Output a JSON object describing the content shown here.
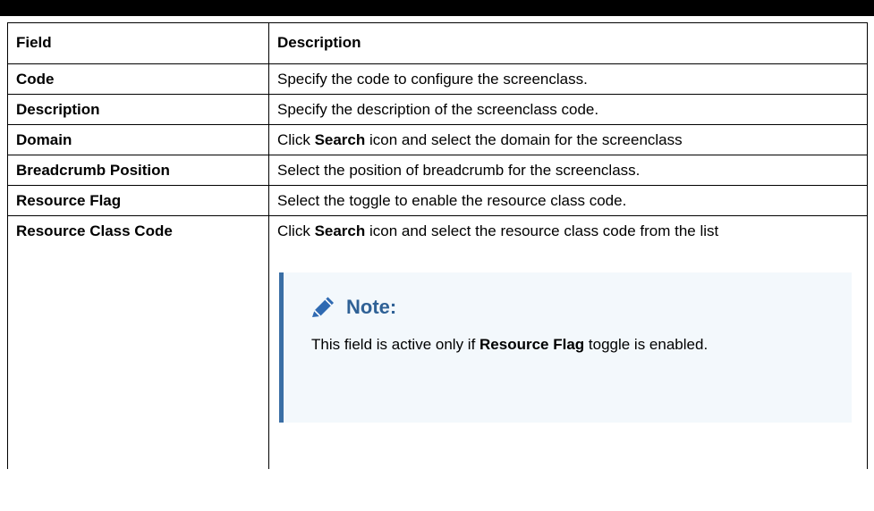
{
  "table": {
    "headers": {
      "field": "Field",
      "description": "Description"
    },
    "rows": [
      {
        "field": "Code",
        "desc_pre": "Specify the code to configure the screenclass.",
        "desc_bold": "",
        "desc_post": ""
      },
      {
        "field": "Description",
        "desc_pre": "Specify the description of the screenclass code.",
        "desc_bold": "",
        "desc_post": ""
      },
      {
        "field": "Domain",
        "desc_pre": "Click ",
        "desc_bold": "Search",
        "desc_post": " icon and select the domain for the screenclass"
      },
      {
        "field": "Breadcrumb Position",
        "desc_pre": "Select the position of breadcrumb for the screenclass.",
        "desc_bold": "",
        "desc_post": ""
      },
      {
        "field": "Resource Flag",
        "desc_pre": "Select the toggle to enable the resource class code.",
        "desc_bold": "",
        "desc_post": ""
      },
      {
        "field": "Resource Class Code",
        "desc_pre": "Click ",
        "desc_bold": "Search",
        "desc_post": " icon and select the resource class code from the list"
      }
    ]
  },
  "note": {
    "icon": "pencil-icon",
    "title": "Note:",
    "body_pre": "This field is active only if ",
    "body_bold": "Resource Flag",
    "body_post": " toggle is enabled."
  },
  "colors": {
    "note_title": "#2f6196",
    "note_border": "#3a6ea5",
    "note_background": "#f3f8fc",
    "pencil_icon": "#2f6ab2"
  }
}
